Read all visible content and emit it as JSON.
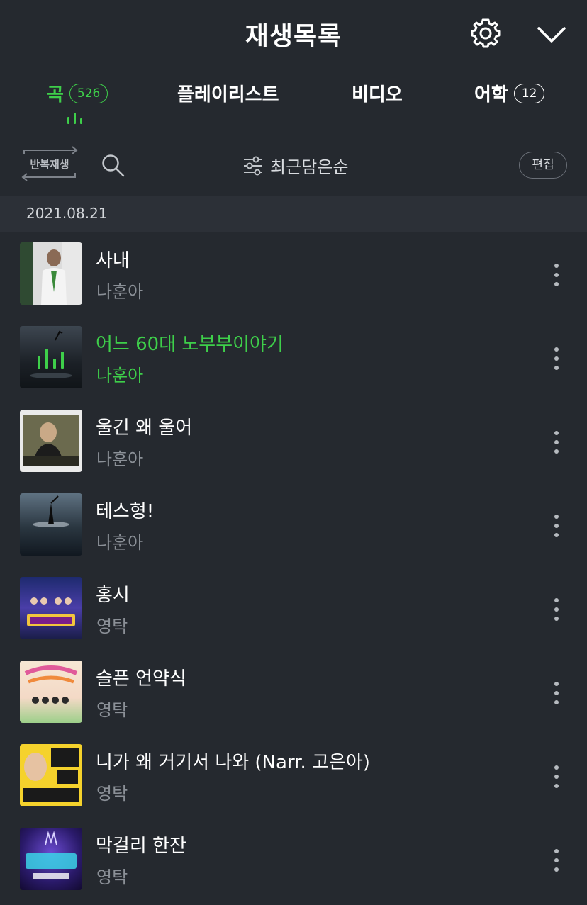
{
  "header": {
    "title": "재생목록",
    "settings_icon": "gear-icon",
    "collapse_icon": "chevron-down-icon"
  },
  "tabs": [
    {
      "label": "곡",
      "badge": "526",
      "active": true
    },
    {
      "label": "플레이리스트",
      "badge": "",
      "active": false
    },
    {
      "label": "비디오",
      "badge": "",
      "active": false
    },
    {
      "label": "어학",
      "badge": "12",
      "active": false
    }
  ],
  "toolbar": {
    "repeat_label": "반복재생",
    "sort_label": "최근담은순",
    "edit_label": "편집"
  },
  "date_header": "2021.08.21",
  "songs": [
    {
      "title": "사내",
      "artist": "나훈아",
      "playing": false
    },
    {
      "title": "어느 60대 노부부이야기",
      "artist": "나훈아",
      "playing": true
    },
    {
      "title": "울긴 왜 울어",
      "artist": "나훈아",
      "playing": false
    },
    {
      "title": "테스형!",
      "artist": "나훈아",
      "playing": false
    },
    {
      "title": "홍시",
      "artist": "영탁",
      "playing": false
    },
    {
      "title": "슬픈 언약식",
      "artist": "영탁",
      "playing": false
    },
    {
      "title": "니가 왜 거기서 나와 (Narr. 고은아)",
      "artist": "영탁",
      "playing": false
    },
    {
      "title": "막걸리 한잔",
      "artist": "영탁",
      "playing": false
    }
  ],
  "colors": {
    "accent": "#3ecf4a",
    "background": "#25292f"
  }
}
